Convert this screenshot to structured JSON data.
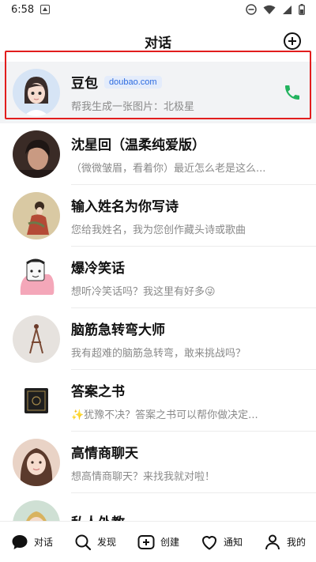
{
  "status": {
    "time": "6:58"
  },
  "header": {
    "title": "对话"
  },
  "conversations": [
    {
      "name": "豆包",
      "tag": "doubao.com",
      "preview": "帮我生成一张图片：北极星",
      "avatar": "doubao-avatar",
      "has_call": true
    },
    {
      "name": "沈星回（温柔纯爱版）",
      "preview": "（微微皱眉，看着你）最近怎么老是这么...",
      "avatar": "shen-xinghui-avatar"
    },
    {
      "name": "输入姓名为你写诗",
      "preview": "您给我姓名，我为您创作藏头诗或歌曲",
      "avatar": "poem-avatar"
    },
    {
      "name": "爆冷笑话",
      "preview": "想听冷笑话吗？我这里有好多😜",
      "avatar": "joke-avatar"
    },
    {
      "name": "脑筋急转弯大师",
      "preview": "我有超难的脑筋急转弯，敢来挑战吗？",
      "avatar": "riddle-avatar"
    },
    {
      "name": "答案之书",
      "preview": "✨犹豫不决？答案之书可以帮你做决定...",
      "avatar": "answer-book-avatar"
    },
    {
      "name": "高情商聊天",
      "preview": "想高情商聊天？来找我就对啦！",
      "avatar": "eq-chat-avatar"
    },
    {
      "name": "私人外教",
      "preview": "",
      "avatar": "tutor-avatar"
    }
  ],
  "nav": [
    {
      "label": "对话",
      "icon": "chat-bubble-icon"
    },
    {
      "label": "发现",
      "icon": "search-icon"
    },
    {
      "label": "创建",
      "icon": "plus-box-icon"
    },
    {
      "label": "通知",
      "icon": "heart-icon"
    },
    {
      "label": "我的",
      "icon": "person-icon"
    }
  ],
  "colors": {
    "accent_blue": "#2d6be0",
    "call_green": "#22b35e",
    "highlight_red": "#e21d1d"
  }
}
